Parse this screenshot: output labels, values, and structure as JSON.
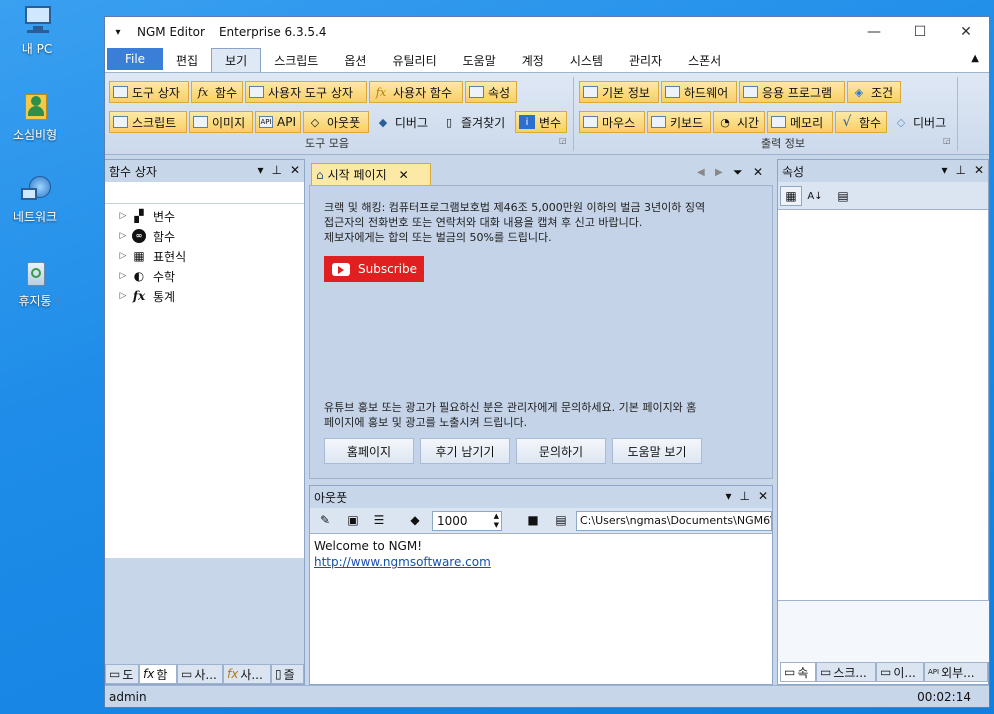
{
  "desktop": {
    "icons": [
      {
        "label": "내 PC",
        "icon": "computer-icon"
      },
      {
        "label": "소심비형",
        "icon": "user-folder-icon"
      },
      {
        "label": "네트워크",
        "icon": "network-icon"
      },
      {
        "label": "휴지통",
        "icon": "recycle-bin-icon"
      }
    ]
  },
  "window": {
    "title": "NGM Editor",
    "edition": "Enterprise 6.3.5.4"
  },
  "menu": {
    "file": "File",
    "items": [
      "편집",
      "보기",
      "스크립트",
      "옵션",
      "유틸리티",
      "도움말",
      "계정",
      "시스템",
      "관리자",
      "스폰서"
    ],
    "active": "보기"
  },
  "ribbon": {
    "group1": {
      "label": "도구 모음",
      "row1": [
        "도구 상자",
        "함수",
        "사용자 도구 상자",
        "사용자 함수",
        "속성"
      ],
      "row2": [
        "스크립트",
        "이미지",
        "API",
        "아웃풋",
        "디버그",
        "즐겨찾기",
        "변수"
      ]
    },
    "group2": {
      "label": "출력 정보",
      "row1": [
        "기본 정보",
        "하드웨어",
        "응용 프로그램",
        "조건"
      ],
      "row2": [
        "마우스",
        "키보드",
        "시간",
        "메모리",
        "함수",
        "디버그"
      ]
    }
  },
  "left_panel": {
    "title": "함수 상자",
    "tree": [
      "변수",
      "함수",
      "표현식",
      "수학",
      "통계"
    ],
    "tabs": [
      "도",
      "함",
      "사...",
      "사...",
      "즐"
    ]
  },
  "start_page": {
    "tab": "시작 페이지",
    "warning_lines": [
      "크랙 및 해킹: 컴퓨터프로그램보호법 제46조 5,000만원 이하의 벌금 3년이하 징역",
      "접근자의 전화번호 또는 연락처와 대화 내용을 캡쳐 후 신고 바랍니다.",
      "제보자에게는 합의 또는 벌금의 50%를 드립니다."
    ],
    "subscribe": "Subscribe",
    "ad_lines": [
      "유튜브 홍보 또는 광고가 필요하신 분은 관리자에게 문의하세요. 기본 페이지와 홈",
      "페이지에 홍보 및 광고를 노출시켜 드립니다."
    ],
    "buttons": [
      "홈페이지",
      "후기 남기기",
      "문의하기",
      "도움말 보기"
    ]
  },
  "output_panel": {
    "title": "아웃풋",
    "count": "1000",
    "path": "C:\\Users\\ngmas\\Documents\\NGM6\\",
    "line1": "Welcome to NGM!",
    "link": "http://www.ngmsoftware.com"
  },
  "right_panel": {
    "title": "속성",
    "tabs": [
      "속",
      "스크...",
      "이...",
      "외부..."
    ]
  },
  "status": {
    "user": "admin",
    "time": "00:02:14"
  }
}
